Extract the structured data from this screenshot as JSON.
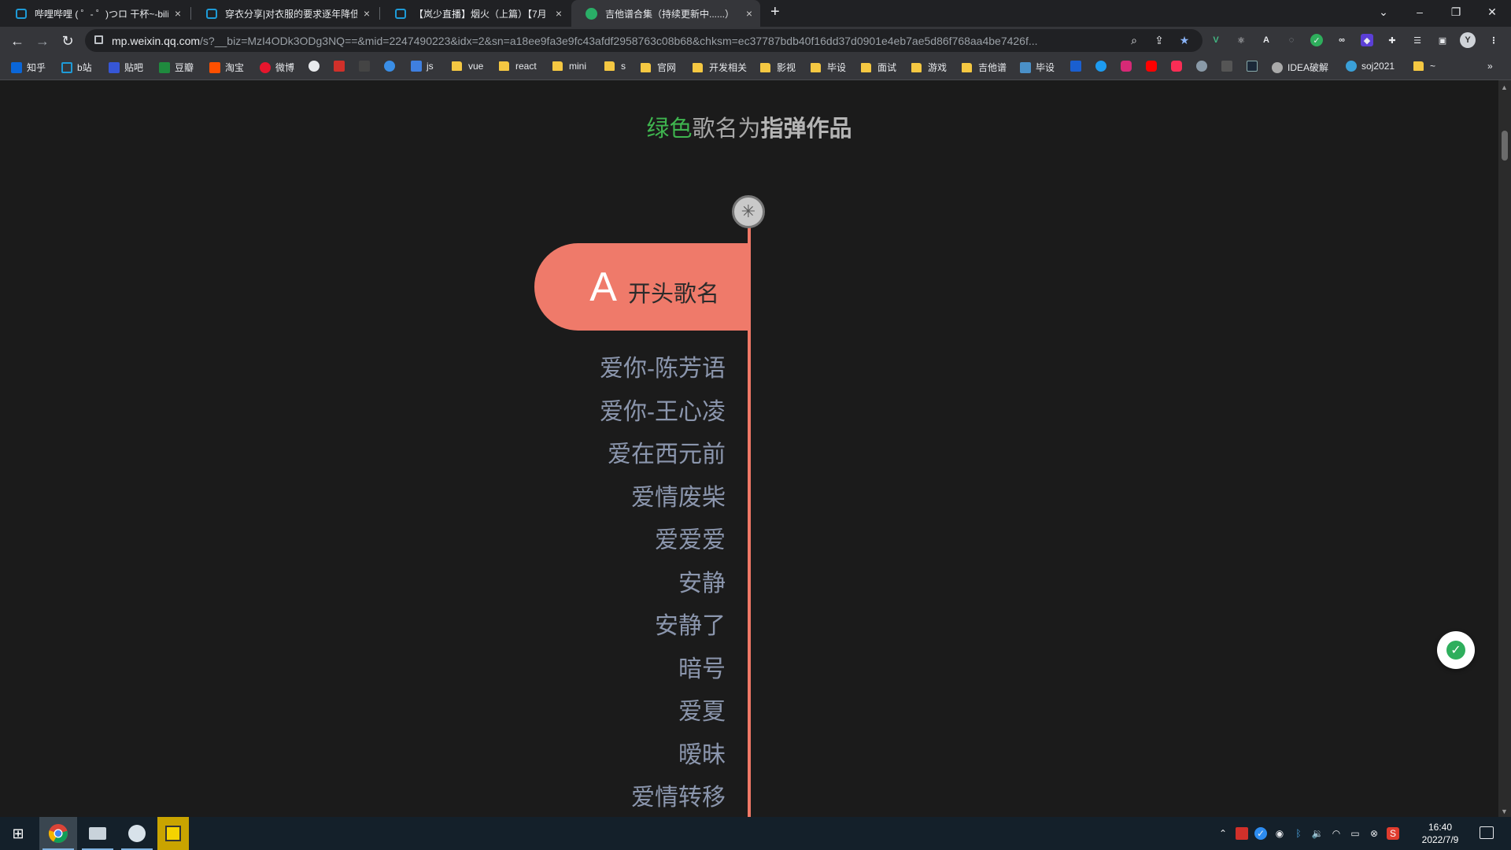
{
  "browser": {
    "tabs": [
      {
        "title": "哔哩哔哩 ( ゜- ゜)つロ 干杯~-bili"
      },
      {
        "title": "穿衣分享|对衣服的要求逐年降低"
      },
      {
        "title": "【岚少直播】烟火（上篇）【7月"
      },
      {
        "title": "吉他谱合集（持续更新中......）"
      }
    ],
    "new_tab": "+",
    "close_glyph": "×",
    "url_host": "mp.weixin.qq.com",
    "url_path": "/s?__biz=MzI4ODk3ODg3NQ==&mid=2247490223&idx=2&sn=a18ee9fa3e9fc43afdf2958763c08b68&chksm=ec37787bdb40f16dd37d0901e4eb7ae5d86f768aa4be7426f...",
    "bookmarks": [
      "知乎",
      "b站",
      "贴吧",
      "豆瓣",
      "淘宝",
      "微博",
      "",
      "",
      "",
      "",
      "js",
      "vue",
      "react",
      "mini",
      "s",
      "官网",
      "开发相关",
      "影视",
      "毕设",
      "面试",
      "游戏",
      "吉他谱",
      "毕设",
      "",
      "",
      "",
      "",
      "",
      "",
      "",
      "",
      "",
      "IDEA破解",
      "soj2021",
      "~"
    ],
    "more": "»"
  },
  "page": {
    "heading_green": "绿色",
    "heading_mid": "歌名为",
    "heading_bold": "指弹作品",
    "section_letter": "A",
    "section_label": "开头歌名",
    "songs": [
      "爱你-陈芳语",
      "爱你-王心凌",
      "爱在西元前",
      "爱情废柴",
      "爱爱爱",
      "安静",
      "安静了",
      "暗号",
      "爱夏",
      "暧昧",
      "爱情转移"
    ]
  },
  "taskbar": {
    "time": "16:40",
    "date": "2022/7/9"
  },
  "colors": {
    "accent_timeline": "#f07866",
    "green": "#3fb54f",
    "song_text": "#8b96ad"
  }
}
